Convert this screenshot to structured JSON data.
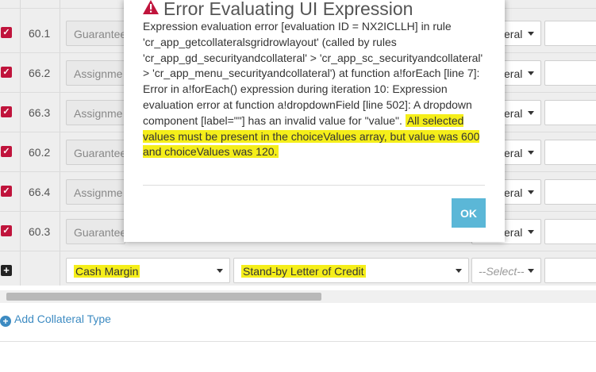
{
  "rows": [
    {
      "num": "60.1",
      "type": "Guarantee"
    },
    {
      "num": "66.2",
      "type": "Assignme"
    },
    {
      "num": "66.3",
      "type": "Assignme"
    },
    {
      "num": "60.2",
      "type": "Guarantee"
    },
    {
      "num": "66.4",
      "type": "Assignme"
    },
    {
      "num": "60.3",
      "type": "Guarantee"
    }
  ],
  "right_dropdown_label": "eral",
  "new_row": {
    "type_value": "Cash Margin",
    "subtype_value": "Stand-by Letter of Credit",
    "select_placeholder": "--Select--"
  },
  "add_link_label": "Add Collateral Type",
  "dialog": {
    "title": "Error Evaluating UI Expression",
    "message": "Expression evaluation error [evaluation ID = NX2ICLLH] in rule 'cr_app_getcollateralsgridrowlayout' (called by rules 'cr_app_gd_securityandcollateral' > 'cr_app_sc_securityandcollateral' > 'cr_app_menu_securityandcollateral') at function a!forEach [line 7]: Error in a!forEach() expression during iteration 10: Expression evaluation error at function a!dropdownField [line 502]: A dropdown component [label=\"\"] has an invalid value for \"value\".",
    "highlighted_message": "All selected values must be present in the choiceValues array, but value was 600 and choiceValues was 120.",
    "ok_label": "OK"
  },
  "colors": {
    "checkbox": "#c0143c",
    "highlight": "#f5ee1a",
    "ok_button": "#5bb7d7",
    "link": "#3d8bc2"
  }
}
